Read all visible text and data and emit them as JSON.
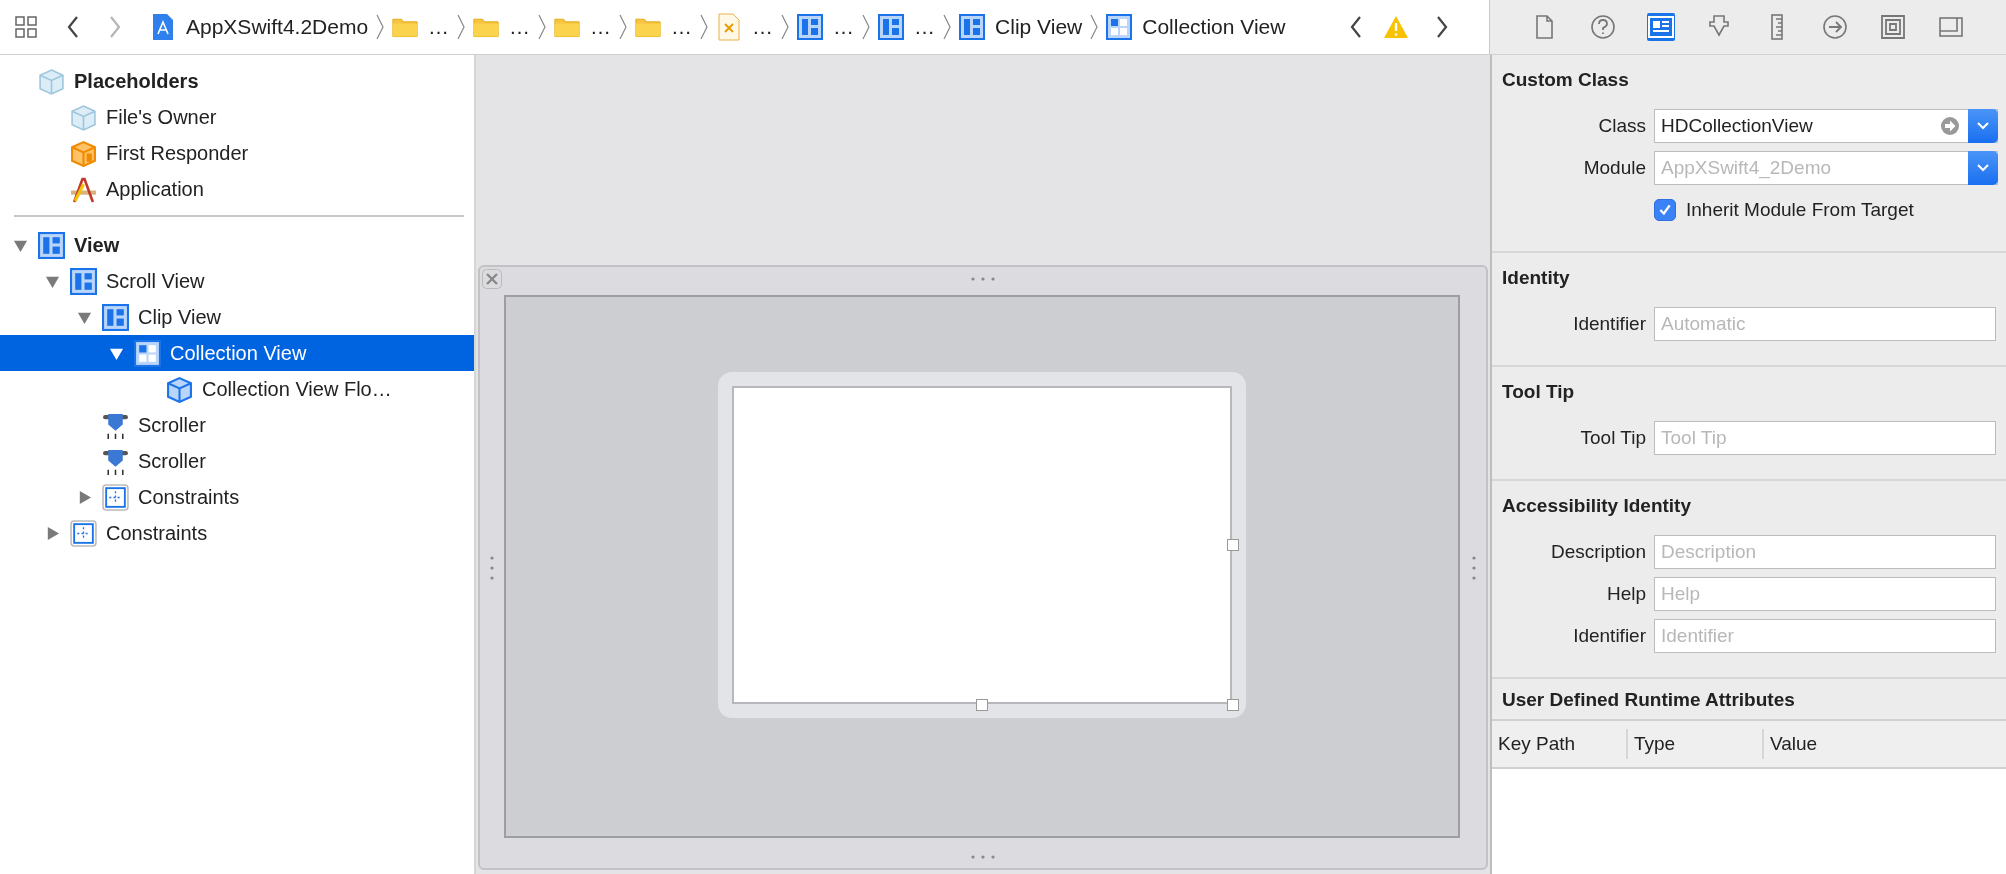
{
  "toolbar": {
    "related_button": {
      "kind": "grid"
    },
    "nav_buttons": [
      {
        "kind": "back",
        "disabled": false
      },
      {
        "kind": "forward",
        "disabled": true
      }
    ],
    "breadcrumbs": [
      {
        "kind": "project",
        "label": "AppXSwift4.2Demo"
      },
      {
        "kind": "folder",
        "label": "…"
      },
      {
        "kind": "folder",
        "label": "…"
      },
      {
        "kind": "folder",
        "label": "…"
      },
      {
        "kind": "folder",
        "label": "…"
      },
      {
        "kind": "xib",
        "label": "…"
      },
      {
        "kind": "view",
        "label": "…"
      },
      {
        "kind": "view",
        "label": "…"
      },
      {
        "kind": "view",
        "label": "Clip View"
      },
      {
        "kind": "collection",
        "label": "Collection View"
      }
    ],
    "issue_nav": {
      "warning": true
    }
  },
  "inspector_tabs": [
    {
      "kind": "file",
      "selected": false
    },
    {
      "kind": "help",
      "selected": false
    },
    {
      "kind": "identity",
      "selected": true
    },
    {
      "kind": "attributes",
      "selected": false
    },
    {
      "kind": "size",
      "selected": false
    },
    {
      "kind": "connections",
      "selected": false
    },
    {
      "kind": "bindings",
      "selected": false
    },
    {
      "kind": "effects",
      "selected": false
    }
  ],
  "outline": {
    "placeholders": {
      "title": "Placeholders",
      "items": [
        {
          "kind": "placeholder",
          "label": "File's Owner"
        },
        {
          "kind": "responder",
          "label": "First Responder"
        },
        {
          "kind": "application",
          "label": "Application"
        }
      ]
    },
    "tree": [
      {
        "kind": "view",
        "label": "View",
        "expanded": true,
        "selected": false,
        "children": [
          {
            "kind": "view",
            "label": "Scroll View",
            "expanded": true,
            "selected": false,
            "children": [
              {
                "kind": "view",
                "label": "Clip View",
                "expanded": true,
                "selected": false,
                "children": [
                  {
                    "kind": "collection",
                    "label": "Collection View",
                    "expanded": true,
                    "selected": true,
                    "children": [
                      {
                        "kind": "object",
                        "label": "Collection View Flo…",
                        "selected": false
                      }
                    ]
                  }
                ]
              },
              {
                "kind": "scroller",
                "label": "Scroller",
                "selected": false
              },
              {
                "kind": "scroller",
                "label": "Scroller",
                "selected": false
              },
              {
                "kind": "constraints",
                "label": "Constraints",
                "expanded": false,
                "selected": false
              }
            ]
          },
          {
            "kind": "constraints",
            "label": "Constraints",
            "expanded": false,
            "selected": false
          }
        ]
      }
    ]
  },
  "inspector": {
    "sections": [
      {
        "title": "Custom Class",
        "fields": [
          {
            "kind": "jumpcombo",
            "label": "Class",
            "value": "HDCollectionView"
          },
          {
            "kind": "combo",
            "label": "Module",
            "placeholder": "AppXSwift4_2Demo"
          },
          {
            "kind": "checkbox",
            "label": "Inherit Module From Target",
            "checked": true
          }
        ]
      },
      {
        "title": "Identity",
        "fields": [
          {
            "kind": "text",
            "label": "Identifier",
            "placeholder": "Automatic"
          }
        ]
      },
      {
        "title": "Tool Tip",
        "fields": [
          {
            "kind": "text",
            "label": "Tool Tip",
            "placeholder": "Tool Tip"
          }
        ]
      },
      {
        "title": "Accessibility Identity",
        "fields": [
          {
            "kind": "text",
            "label": "Description",
            "placeholder": "Description"
          },
          {
            "kind": "text",
            "label": "Help",
            "placeholder": "Help"
          },
          {
            "kind": "text",
            "label": "Identifier",
            "placeholder": "Identifier"
          }
        ]
      }
    ],
    "attributes_table": {
      "title": "User Defined Runtime Attributes",
      "columns": [
        "Key Path",
        "Type",
        "Value"
      ]
    }
  }
}
